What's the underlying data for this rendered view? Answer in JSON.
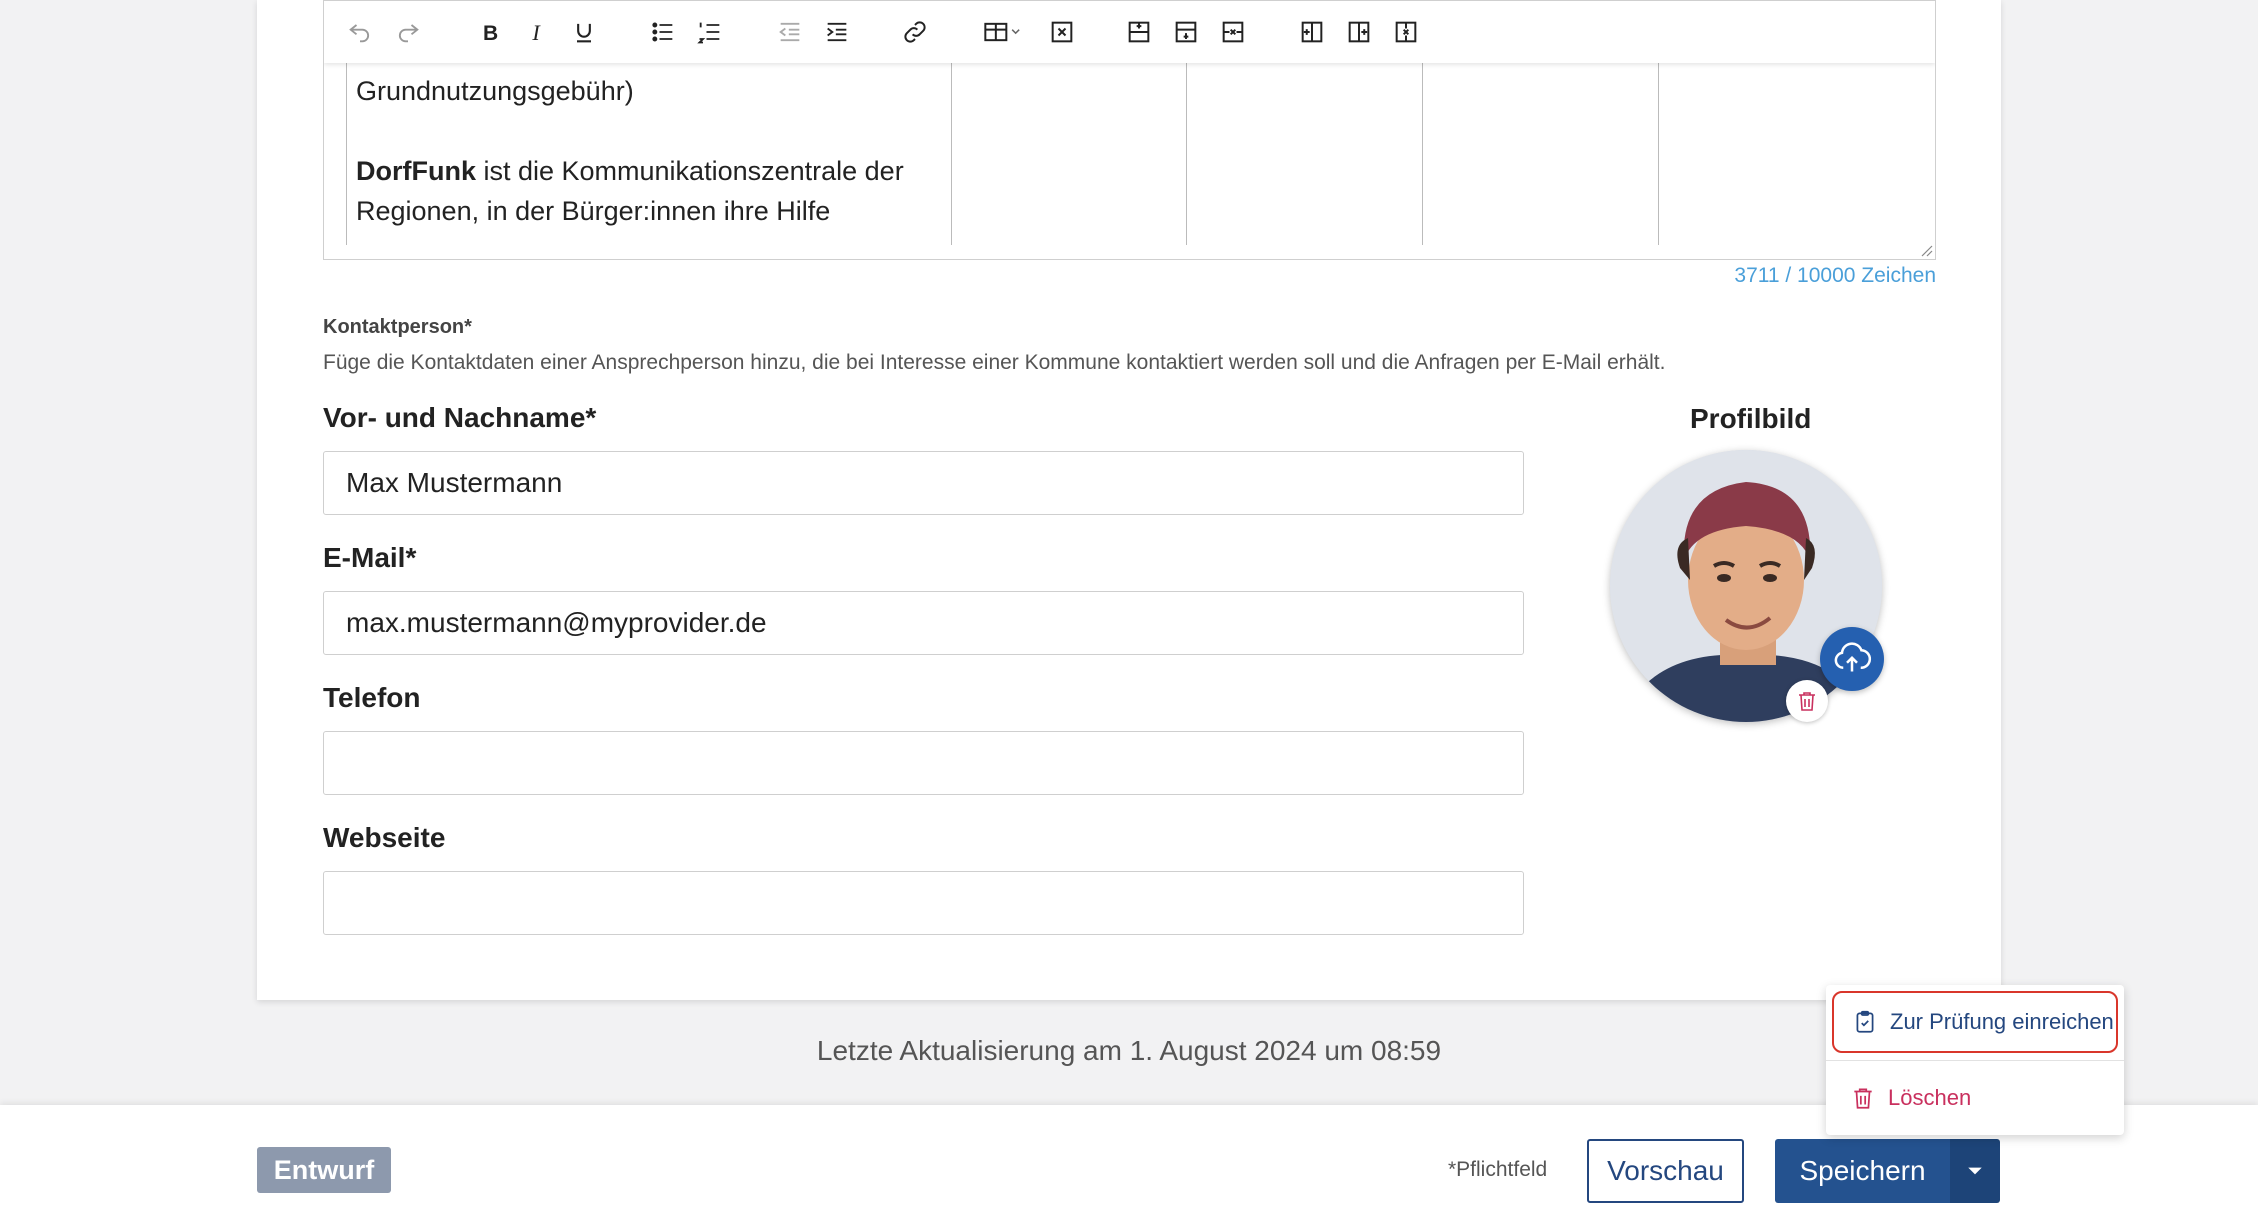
{
  "editor": {
    "toolbar": [
      {
        "name": "undo-icon"
      },
      {
        "name": "redo-icon"
      },
      {
        "name": "bold-icon"
      },
      {
        "name": "italic-icon"
      },
      {
        "name": "underline-icon"
      },
      {
        "name": "bulleted-list-icon"
      },
      {
        "name": "numbered-list-icon"
      },
      {
        "name": "outdent-icon"
      },
      {
        "name": "indent-icon"
      },
      {
        "name": "link-icon"
      },
      {
        "name": "table-icon"
      },
      {
        "name": "delete-table-icon"
      },
      {
        "name": "insert-row-above-icon"
      },
      {
        "name": "insert-row-below-icon"
      },
      {
        "name": "delete-row-icon"
      },
      {
        "name": "insert-column-left-icon"
      },
      {
        "name": "insert-column-right-icon"
      },
      {
        "name": "delete-column-icon"
      }
    ],
    "line1": "Grundnutzungsgebühr)",
    "bold_word": "DorfFunk",
    "line2_rest": " ist die Kommunikationszentrale der",
    "line3": "Regionen, in der Bürger:innen ihre Hilfe",
    "char_count": "3711 / 10000 Zeichen"
  },
  "contact": {
    "section_label": "Kontaktperson*",
    "section_desc": "Füge die Kontaktdaten einer Ansprechperson hinzu, die bei Interesse einer Kommune kontaktiert werden soll und die Anfragen per E-Mail erhält.",
    "name_label": "Vor- und Nachname*",
    "name_value": "Max Mustermann",
    "email_label": "E-Mail*",
    "email_value": "max.mustermann@myprovider.de",
    "phone_label": "Telefon",
    "phone_value": "",
    "website_label": "Webseite",
    "website_value": "",
    "profile_label": "Profilbild"
  },
  "last_update": "Letzte Aktualisierung am 1. August 2024 um 08:59",
  "footer": {
    "status": "Entwurf",
    "required_note": "*Pflichtfeld",
    "preview_label": "Vorschau",
    "save_label": "Speichern"
  },
  "dropdown": {
    "submit_label": "Zur Prüfung einreichen",
    "delete_label": "Löschen"
  },
  "colors": {
    "accent": "#24528f",
    "link": "#4a9fd9",
    "danger": "#c9305e",
    "highlight": "#d9362b",
    "badge": "#8d99ad"
  }
}
